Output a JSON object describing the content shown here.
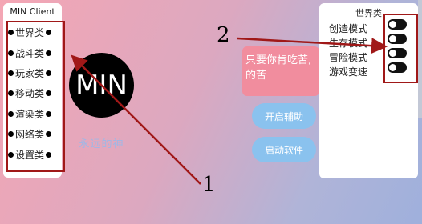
{
  "left_panel": {
    "title": "MIN Client",
    "categories": [
      "世界类",
      "战斗类",
      "玩家类",
      "移动类",
      "渲染类",
      "网络类",
      "设置类"
    ]
  },
  "logo": {
    "text": "MIN",
    "subtext": "永远的神"
  },
  "center": {
    "card_text_line1": "只要你肯吃苦,",
    "card_text_line2": "的苦",
    "assist_button": "开启辅助",
    "launch_button": "启动软件"
  },
  "right_panel": {
    "title": "世界类",
    "options": [
      "创造模式",
      "生存模式",
      "冒险模式",
      "游戏变速"
    ]
  },
  "annotations": {
    "label_1": "1",
    "label_2": "2"
  },
  "colors": {
    "highlight_box": "#a01818",
    "button": "#8ac2ee",
    "card": "#f18d9e"
  }
}
